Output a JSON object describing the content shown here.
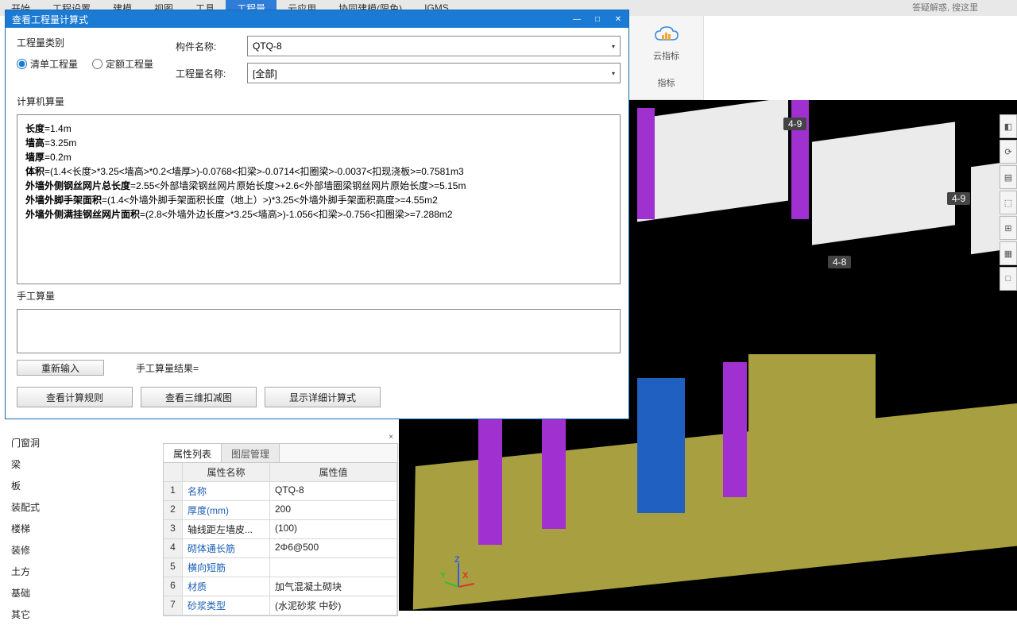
{
  "menu": {
    "items": [
      "开始",
      "工程设置",
      "建模",
      "视图",
      "工具",
      "工程量",
      "云应用",
      "协同建模(限免)",
      "IGMS"
    ],
    "active_index": 5
  },
  "search_placeholder": "答疑解惑, 搜这里",
  "cloud_panel": {
    "label1": "云指标",
    "label2": "指标"
  },
  "dialog": {
    "title": "查看工程量计算式",
    "cat_title": "工程量类别",
    "radio_bill": "清单工程量",
    "radio_fixed": "定额工程量",
    "component_label": "构件名称:",
    "component_value": "QTQ-8",
    "quantity_label": "工程量名称:",
    "quantity_value": "[全部]",
    "computer_section": "计算机算量",
    "formula_lines": [
      {
        "label": "长度",
        "rest": "=1.4m"
      },
      {
        "label": "墙高",
        "rest": "=3.25m"
      },
      {
        "label": "墙厚",
        "rest": "=0.2m"
      },
      {
        "label": "体积",
        "rest": "=(1.4<长度>*3.25<墙高>*0.2<墙厚>)-0.0768<扣梁>-0.0714<扣圈梁>-0.0037<扣现浇板>=0.7581m3"
      },
      {
        "label": "外墙外侧钢丝网片总长度",
        "rest": "=2.55<外部墙梁钢丝网片原始长度>+2.6<外部墙圈梁钢丝网片原始长度>=5.15m"
      },
      {
        "label": "外墙外脚手架面积",
        "rest": "=(1.4<外墙外脚手架面积长度（地上）>)*3.25<外墙外脚手架面积高度>=4.55m2"
      },
      {
        "label": "外墙外侧满挂钢丝网片面积",
        "rest": "=(2.8<外墙外边长度>*3.25<墙高>)-1.056<扣梁>-0.756<扣圈梁>=7.288m2"
      }
    ],
    "manual_section": "手工算量",
    "btn_reload": "重新输入",
    "manual_result_label": "手工算量结果=",
    "btn_rule": "查看计算规则",
    "btn_3d": "查看三维扣减图",
    "btn_detail": "显示详细计算式"
  },
  "left_tree": [
    "门窗洞",
    "梁",
    "板",
    "装配式",
    "楼梯",
    "装修",
    "土方",
    "基础",
    "其它"
  ],
  "prop_panel": {
    "tab_active": "属性列表",
    "tab_inactive": "图层管理",
    "header_name": "属性名称",
    "header_value": "属性值",
    "rows": [
      {
        "i": "1",
        "k": "名称",
        "v": "QTQ-8",
        "link": true
      },
      {
        "i": "2",
        "k": "厚度(mm)",
        "v": "200",
        "link": true
      },
      {
        "i": "3",
        "k": "轴线距左墙皮...",
        "v": "(100)",
        "link": false
      },
      {
        "i": "4",
        "k": "砌体通长筋",
        "v": "2Φ6@500",
        "link": true
      },
      {
        "i": "5",
        "k": "横向短筋",
        "v": "",
        "link": true
      },
      {
        "i": "6",
        "k": "材质",
        "v": "加气混凝土砌块",
        "link": true
      },
      {
        "i": "7",
        "k": "砂浆类型",
        "v": "(水泥砂浆 中砂)",
        "link": true
      }
    ]
  },
  "axis_labels": [
    "4-9",
    "4-9",
    "4-8"
  ],
  "win_buttons": {
    "min": "—",
    "max": "□",
    "close": "✕"
  }
}
